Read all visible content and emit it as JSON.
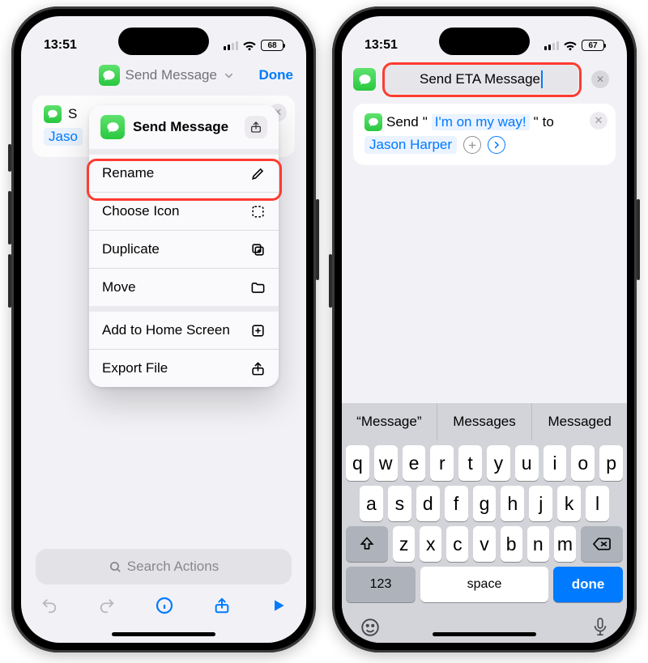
{
  "status": {
    "time": "13:51",
    "battery_left": "68",
    "battery_right": "67"
  },
  "left": {
    "title": "Send Message",
    "done": "Done",
    "card_prefix": "S",
    "card_recipient_partial": "Jaso",
    "popover": {
      "title": "Send Message",
      "items": [
        {
          "label": "Rename",
          "icon": "pencil"
        },
        {
          "label": "Choose Icon",
          "icon": "dashed-square"
        },
        {
          "label": "Duplicate",
          "icon": "plus-square-on-square"
        },
        {
          "label": "Move",
          "icon": "folder"
        }
      ],
      "items2": [
        {
          "label": "Add to Home Screen",
          "icon": "plus-square"
        },
        {
          "label": "Export File",
          "icon": "share"
        }
      ]
    },
    "search_placeholder": "Search Actions"
  },
  "right": {
    "title_value": "Send ETA Message",
    "card": {
      "prefix": "Send",
      "q1": "\"",
      "token": "I'm on my way!",
      "q2": "\"",
      "suffix": "to",
      "recipient": "Jason Harper"
    },
    "suggestions": [
      "“Message”",
      "Messages",
      "Messaged"
    ],
    "rows": [
      [
        "q",
        "w",
        "e",
        "r",
        "t",
        "y",
        "u",
        "i",
        "o",
        "p"
      ],
      [
        "a",
        "s",
        "d",
        "f",
        "g",
        "h",
        "j",
        "k",
        "l"
      ],
      [
        "z",
        "x",
        "c",
        "v",
        "b",
        "n",
        "m"
      ]
    ],
    "numkey": "123",
    "space": "space",
    "done": "done"
  }
}
